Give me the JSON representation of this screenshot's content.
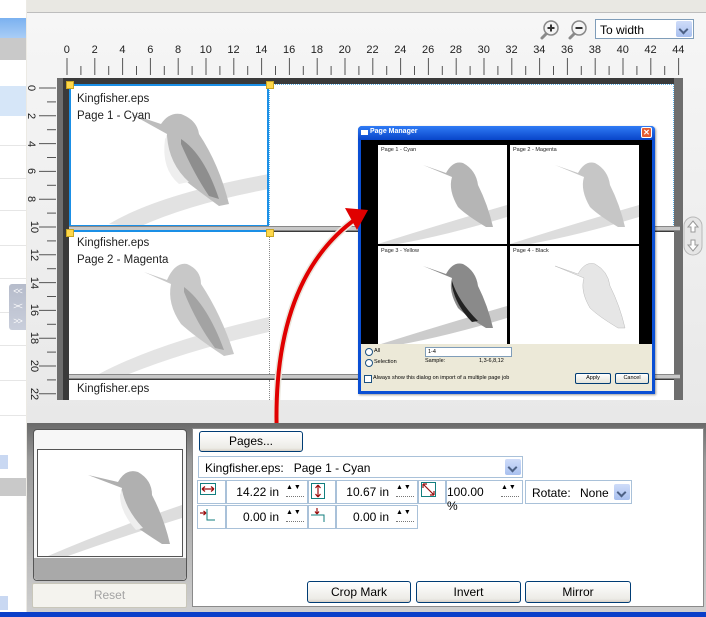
{
  "toolbar": {
    "zoom_in_icon": "zoom-in-icon",
    "zoom_out_icon": "zoom-out-icon",
    "zoom_mode": "To width"
  },
  "rulers": {
    "horizontal": [
      "0",
      "2",
      "4",
      "6",
      "8",
      "10",
      "12",
      "14",
      "16",
      "18",
      "20",
      "22",
      "24",
      "26",
      "28",
      "30",
      "32",
      "34",
      "36",
      "38",
      "40",
      "42",
      "44"
    ],
    "vertical": [
      "0",
      "2",
      "4",
      "6",
      "8",
      "10",
      "12",
      "14",
      "16",
      "18",
      "20",
      "22"
    ]
  },
  "canvas": {
    "pages": [
      {
        "file": "Kingfisher.eps",
        "page": "Page 1 - Cyan"
      },
      {
        "file": "Kingfisher.eps",
        "page": "Page 2 - Magenta"
      },
      {
        "file": "Kingfisher.eps",
        "page": ""
      }
    ]
  },
  "dialog": {
    "title": "Page Manager",
    "close_icon": "close-icon",
    "thumbnails": [
      "Page 1 - Cyan",
      "Page 2 - Magenta",
      "Page 3 - Yellow",
      "Page 4 - Black"
    ],
    "radio_all": "All",
    "radio_selection": "Selection",
    "range_value": "1-4",
    "sample_label": "Sample:",
    "sample_value": "1,3-6,8,12",
    "checkbox_label": "Always show this dialog on import of a multiple page job",
    "apply": "Apply",
    "cancel": "Cancel"
  },
  "sidebar_toggles": [
    "<<",
    "><",
    ">>"
  ],
  "bottom": {
    "reset": "Reset",
    "pages_button": "Pages...",
    "page_select": "Kingfisher.eps:   Page 1 - Cyan",
    "width_value": "14.22 in",
    "height_value": "10.67 in",
    "scale_value": "100.00 %",
    "rotate_label": "Rotate:",
    "rotate_value": "None",
    "offset_x_value": "0.00 in",
    "offset_y_value": "0.00 in",
    "spin_glyph": "▲▼",
    "crop_mark": "Crop Mark",
    "invert": "Invert",
    "mirror": "Mirror"
  }
}
